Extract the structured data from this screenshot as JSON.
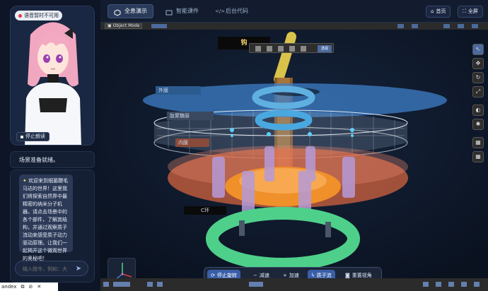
{
  "left": {
    "voice_badge": "语音暂时不可用",
    "stop_read_label": "停止朗读",
    "status_text": "场景准备就绪。",
    "chat_message": "欢迎来到细菌鞭毛马达的世界！这里我们将探索自然界中最精密的纳米分子机器。请点击场景中的各个部件，了解其结构，并通过观察质子流动来感受质子动力驱动原理。让我们一起揭开这个微观世界的奥秘吧！",
    "chat_message_icon": "sparkle-icon",
    "input_placeholder": "输入指令，例如：大"
  },
  "tabs": [
    {
      "label": "全息演示",
      "icon": "cube-icon",
      "active": true
    },
    {
      "label": "智能课件",
      "icon": "slides-icon",
      "active": false
    },
    {
      "label": "后台代码",
      "icon": "code-icon",
      "active": false
    }
  ],
  "top_buttons": {
    "home": "首页",
    "fullscreen": "全屏"
  },
  "viewport": {
    "mode": "Object Mode",
    "float_toolbar_btn": "透视",
    "labels": {
      "hook": "钩",
      "outer_membrane": "外膜",
      "peptidoglycan": "肽聚糖层",
      "inner_membrane": "内膜",
      "c_ring": "C环"
    }
  },
  "bottom_bar": {
    "stop_rotate": "停止旋转",
    "slow_down": "减速",
    "speed_up": "加速",
    "proton_flow": "质子流",
    "reset_view": "重置视角"
  },
  "colors": {
    "accent": "#3a5fa8",
    "outer_membrane": "#3d7fc8",
    "inner_membrane": "#e06840",
    "c_ring": "#4ed08a",
    "hook": "#d9c24a"
  },
  "watermark": {
    "text": "andex"
  }
}
